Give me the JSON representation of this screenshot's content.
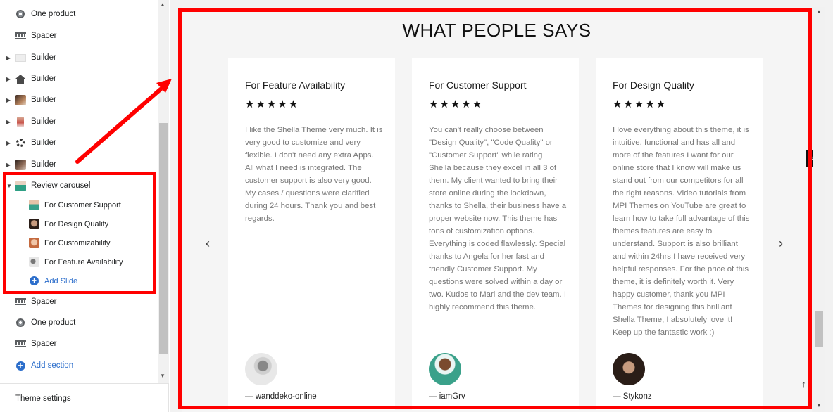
{
  "sidebar": {
    "items": [
      {
        "label": "One product",
        "icon": "product-icon"
      },
      {
        "label": "Spacer",
        "icon": "spacer-icon"
      },
      {
        "label": "Builder",
        "icon": "builder-thumb-icon"
      },
      {
        "label": "Builder",
        "icon": "home-icon"
      },
      {
        "label": "Builder",
        "icon": "builder-photo-icon"
      },
      {
        "label": "Builder",
        "icon": "builder-person-icon"
      },
      {
        "label": "Builder",
        "icon": "builder-gear-icon"
      },
      {
        "label": "Builder",
        "icon": "builder-photo-icon"
      },
      {
        "label": "Review carousel",
        "icon": "review-carousel-icon"
      }
    ],
    "review_children": [
      {
        "label": "For Customer Support",
        "thumb_color": "#3aa18a"
      },
      {
        "label": "For Design Quality",
        "thumb_color": "#5a3b2e"
      },
      {
        "label": "For Customizability",
        "thumb_color": "#c46a3f"
      },
      {
        "label": "For Feature Availability",
        "thumb_color": "#bfbfbf"
      }
    ],
    "add_slide": "Add Slide",
    "after_items": [
      {
        "label": "Spacer",
        "icon": "spacer-icon"
      },
      {
        "label": "One product",
        "icon": "product-icon"
      },
      {
        "label": "Spacer",
        "icon": "spacer-icon"
      }
    ],
    "add_section": "Add section",
    "footer": "Theme settings"
  },
  "preview": {
    "section_title": "WHAT PEOPLE SAYS",
    "cards": [
      {
        "title": "For Feature Availability",
        "stars": "★★★★★",
        "body": "I like the Shella Theme very much. It is very good to customize and very flexible. I don't need any extra Apps. All what I need is integrated. The customer support is also very good. My cases / questions were clarified during 24 hours. Thank you and best regards.",
        "author": "— wanddeko-online",
        "avatar_color": "#d9d9d9"
      },
      {
        "title": "For Customer Support",
        "stars": "★★★★★",
        "body": "You can't really choose between \"Design Quality\", \"Code Quality\" or \"Customer Support\" while rating Shella because they excel in all 3 of them. My client wanted to bring their store online during the lockdown, thanks to Shella, their business have a proper website now. This theme has tons of customization options. Everything is coded flawlessly. Special thanks to Angela for her fast and friendly Customer Support. My questions were solved within a day or two. Kudos to Mari and the dev team. I highly recommend this theme.",
        "author": "— iamGrv",
        "avatar_color": "#3aa18a"
      },
      {
        "title": "For Design Quality",
        "stars": "★★★★★",
        "body": "I love everything about this theme, it is intuitive, functional and has all and more of the features I want for our online store that I know will make us stand out from our competitors for all the right reasons. Video tutorials from MPI Themes on YouTube are great to learn how to take full advantage of this themes features are easy to understand. Support is also brilliant and within 24hrs I have received very helpful responses. For the price of this theme, it is definitely worth it. Very happy customer, thank you MPI Themes for designing this brilliant Shella Theme, I absolutely love it! Keep up the fantastic work :)",
        "author": "— Stykonz",
        "avatar_color": "#2a1d17"
      }
    ],
    "prev_arrow": "‹",
    "next_arrow": "›",
    "to_top": "↑"
  },
  "colors": {
    "highlight": "#ff0000",
    "link": "#2c6ecb"
  }
}
